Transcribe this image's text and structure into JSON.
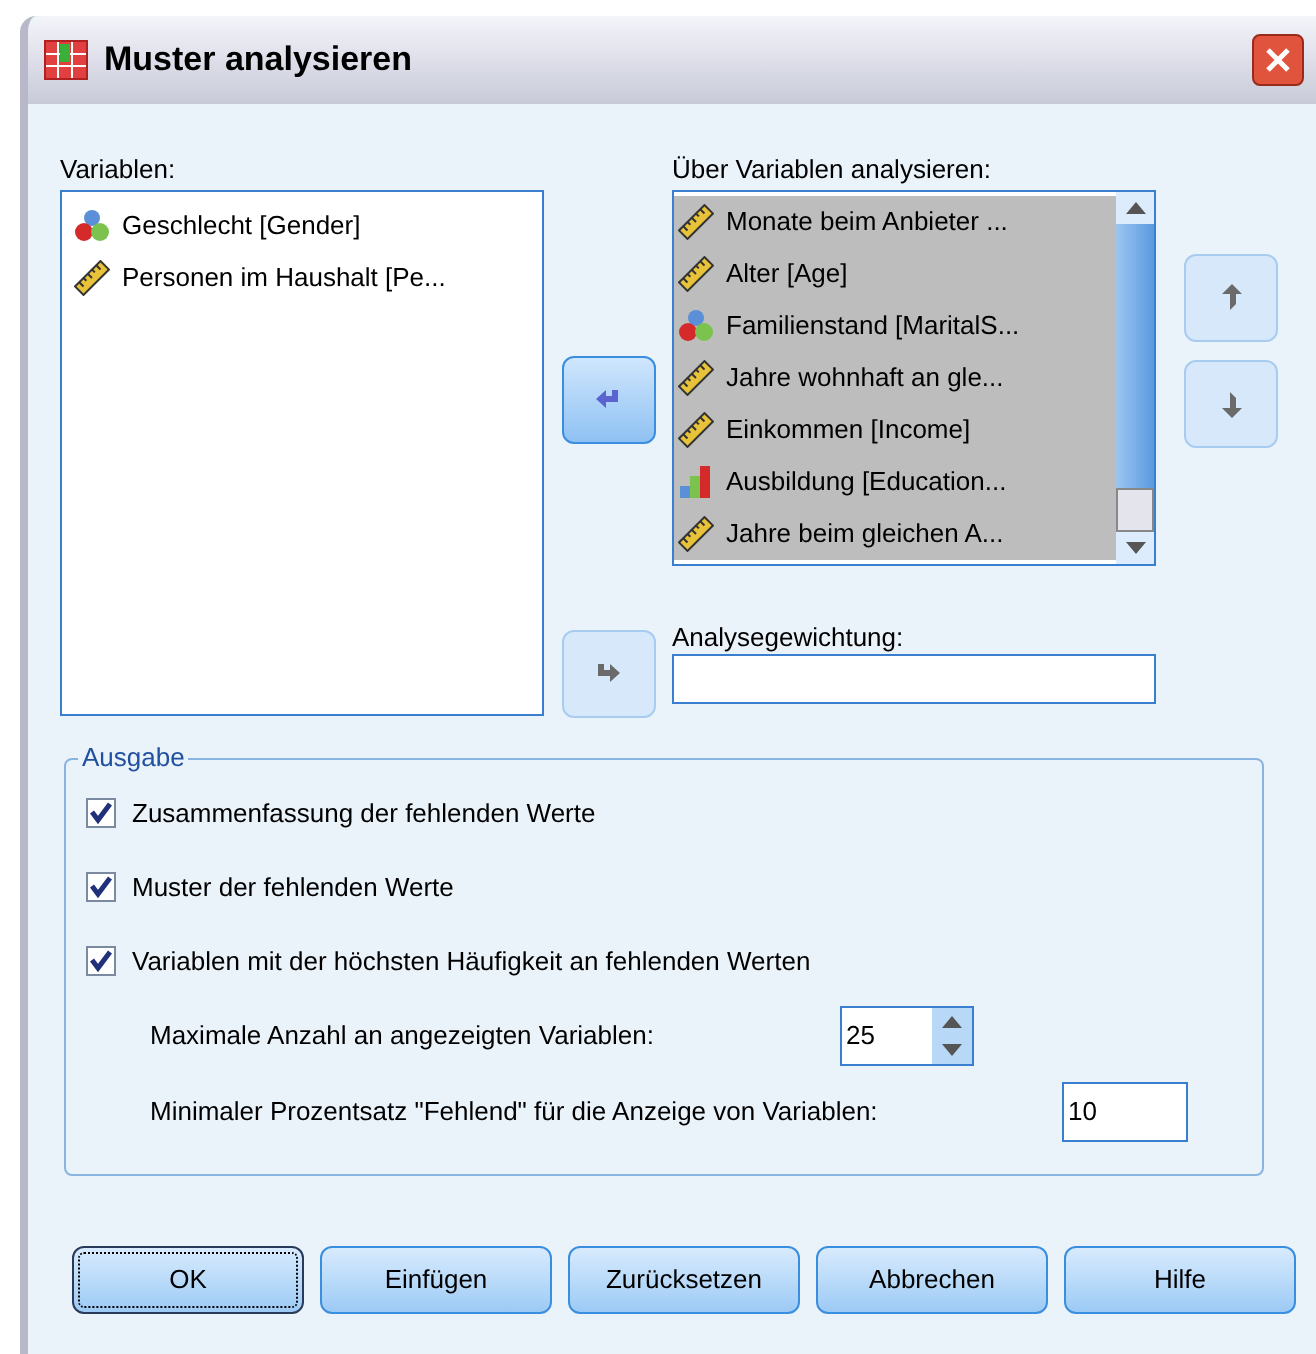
{
  "window": {
    "title": "Muster analysieren"
  },
  "variables": {
    "label": "Variablen:",
    "items": [
      {
        "name": "Geschlecht [Gender]",
        "kind": "nominal",
        "selected": false
      },
      {
        "name": "Personen im Haushalt [Pe...",
        "kind": "scale",
        "selected": false
      }
    ]
  },
  "analyze": {
    "label": "Über Variablen analysieren:",
    "items": [
      {
        "name": "Monate beim Anbieter ...",
        "kind": "scale",
        "selected": true
      },
      {
        "name": "Alter [Age]",
        "kind": "scale",
        "selected": true
      },
      {
        "name": "Familienstand [MaritalS...",
        "kind": "nominal",
        "selected": true
      },
      {
        "name": "Jahre wohnhaft an gle...",
        "kind": "scale",
        "selected": true
      },
      {
        "name": "Einkommen [Income]",
        "kind": "scale",
        "selected": true
      },
      {
        "name": "Ausbildung [Education...",
        "kind": "ordinal",
        "selected": true
      },
      {
        "name": "Jahre beim gleichen A...",
        "kind": "scale",
        "selected": true
      }
    ]
  },
  "move_buttons": [
    {
      "disabled": false
    },
    {
      "disabled": true
    }
  ],
  "order_buttons": [
    {
      "disabled": true
    },
    {
      "disabled": true
    }
  ],
  "weight": {
    "label": "Analysegewichtung:"
  },
  "output": {
    "title": "Ausgabe",
    "options": [
      {
        "label": "Zusammenfassung der fehlenden Werte",
        "checked": true
      },
      {
        "label": "Muster der fehlenden Werte",
        "checked": true
      },
      {
        "label": "Variablen mit der höchsten Häufigkeit an fehlenden Werten",
        "checked": true
      }
    ],
    "max_label": "Maximale Anzahl an angezeigten Variablen:",
    "max_value": "25",
    "min_label": "Minimaler Prozentsatz \"Fehlend\" für die Anzeige von Variablen:",
    "min_value": "10"
  },
  "buttons": [
    {
      "label": "OK",
      "selected": true
    },
    {
      "label": "Einfügen",
      "selected": false
    },
    {
      "label": "Zurücksetzen",
      "selected": false
    },
    {
      "label": "Abbrechen",
      "selected": false
    },
    {
      "label": "Hilfe",
      "selected": false
    }
  ]
}
